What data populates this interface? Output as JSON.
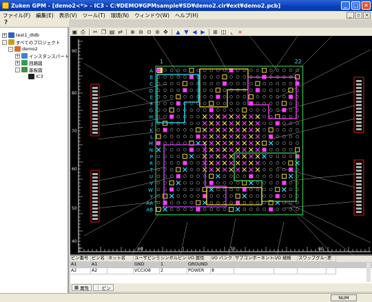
{
  "window": {
    "title": "Zuken GPM - [demo2<*> - IC3 - C:¥DEMO¥GPMsample¥SD¥demo2.cir¥ext¥demo2.pcb]"
  },
  "menu": [
    "ファイル(F)",
    "編集(E)",
    "表示(V)",
    "ツール(T)",
    "環境(N)",
    "ウィンドウ(W)",
    "ヘルプ(H)"
  ],
  "tree": {
    "items": [
      {
        "label": "test1_dldb",
        "expander": "+",
        "icon": "database-icon",
        "color": "#3060c0"
      },
      {
        "label": "すべてのプロジェクト",
        "expander": "-",
        "icon": "projects-icon",
        "color": "#c0a020"
      },
      {
        "label": "demo2",
        "expander": "-",
        "icon": "project-icon",
        "color": "#d07030"
      },
      {
        "label": "インスタンスパート",
        "expander": "+",
        "icon": "instance-icon",
        "color": "#4080d0"
      },
      {
        "label": "回路図",
        "expander": "+",
        "icon": "schematic-icon",
        "color": "#30a050"
      },
      {
        "label": "基板図",
        "expander": "-",
        "icon": "board-icon",
        "color": "#409040"
      },
      {
        "label": "IC3",
        "expander": "",
        "icon": "chip-icon",
        "color": "#202020"
      }
    ]
  },
  "canvas": {
    "col_first": "1",
    "col_last": "22",
    "row_labels": [
      "A",
      "B",
      "C",
      "D",
      "E",
      "F",
      "G",
      "H",
      "J",
      "K",
      "L",
      "M",
      "N",
      "P",
      "R",
      "T",
      "U",
      "V",
      "W",
      "Y",
      "AA",
      "AB"
    ],
    "scale_left": [
      "90",
      "80",
      "70",
      "60",
      "50",
      "40"
    ],
    "scale_bottom": [
      "60",
      "70",
      "80"
    ],
    "colors": {
      "background": "#000000",
      "grid_dot": "#8a8a8a",
      "cyan": "#32e2ff",
      "yellow": "#f0e040",
      "magenta": "#ff40ff",
      "green": "#40e060",
      "purple": "#d040ff",
      "white_lines": "#cfcfcf",
      "ruler": "#e8e8e8"
    }
  },
  "table": {
    "columns": [
      "ピン番号",
      "ピン名",
      "ネット名",
      "ユーザピンラベル",
      "シンボルピン ID",
      "I/O 属性",
      "I/O バンク",
      "サブコンポーネントグループ",
      "I/O 規格",
      "スワップグループ",
      "差"
    ],
    "rows": [
      [
        "A1",
        "A1",
        "",
        "GND",
        "1",
        "GROUND",
        "",
        "",
        "",
        "",
        ""
      ],
      [
        "A2",
        "A2",
        "",
        "VCCIO8",
        "2",
        "POWER",
        "8",
        "",
        "",
        "",
        ""
      ]
    ]
  },
  "bottom_tabs": [
    {
      "label": "属性",
      "icon": "grid-icon"
    },
    {
      "label": "ピン",
      "icon": "pin-icon"
    }
  ],
  "status": {
    "num": "NUM"
  }
}
